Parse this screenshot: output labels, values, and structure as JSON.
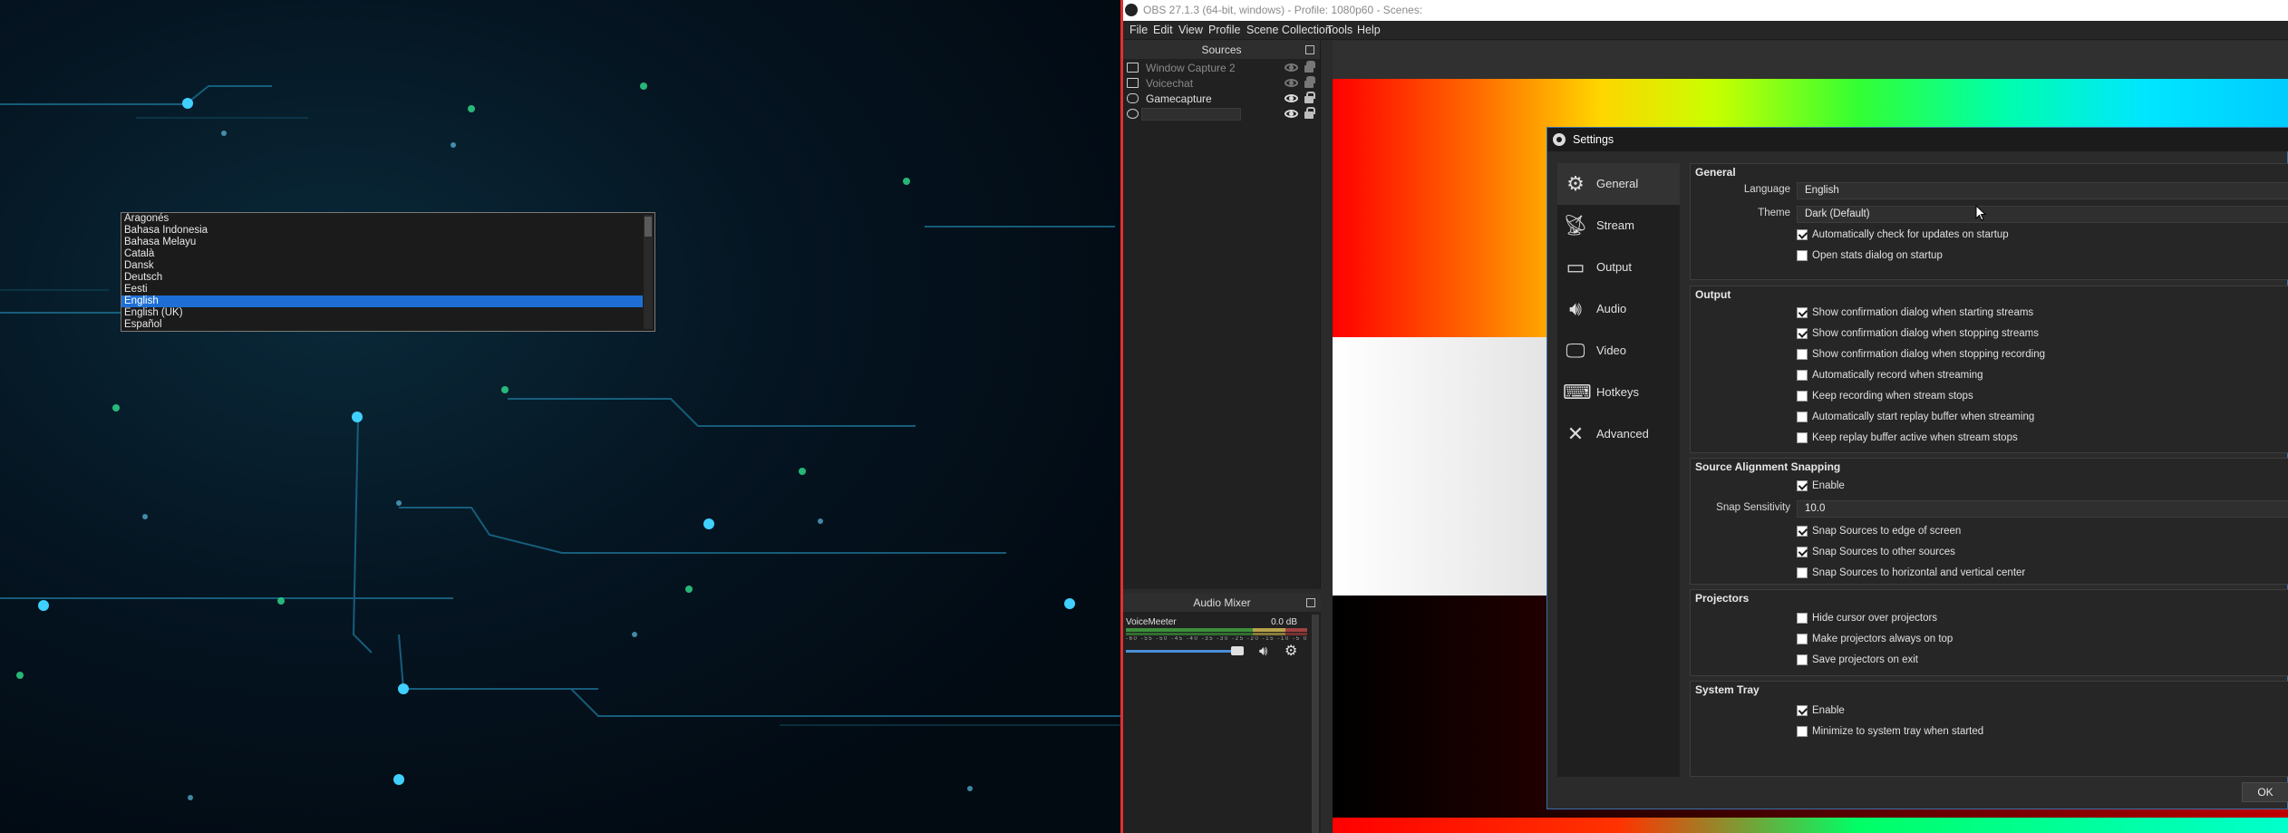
{
  "language_dropdown": {
    "items": [
      "Aragonés",
      "Bahasa Indonesia",
      "Bahasa Melayu",
      "Català",
      "Dansk",
      "Deutsch",
      "Eesti",
      "English",
      "English (UK)",
      "Español"
    ],
    "selected": "English",
    "selected_color": "#1d6fd6"
  },
  "obs": {
    "title": "OBS 27.1.3 (64-bit, windows) - Profile: 1080p60 - Scenes:",
    "menu": [
      "File",
      "Edit",
      "View",
      "Profile",
      "Scene Collection",
      "Tools",
      "Help"
    ],
    "sources": {
      "title": "Sources",
      "items": [
        {
          "name": "Window Capture 2",
          "visible": false,
          "icon": "window-icon"
        },
        {
          "name": "Voicechat",
          "visible": false,
          "icon": "list-icon"
        },
        {
          "name": "Gamecapture",
          "visible": true,
          "icon": "gamepad-icon"
        },
        {
          "name": "",
          "visible": true,
          "icon": "globe-icon",
          "renaming": true
        }
      ],
      "toolbar": [
        "+",
        "−",
        "⚙",
        "∧",
        "∨"
      ]
    },
    "audio_mixer": {
      "title": "Audio Mixer",
      "channel": {
        "name": "VoiceMeeter",
        "db": "0.0 dB",
        "ticks": "-60 -55 -50 -45 -40 -35 -30 -25 -20 -15 -10 -5 0",
        "volume_percent": 88
      }
    }
  },
  "settings": {
    "title": "Settings",
    "nav": [
      {
        "label": "General",
        "icon": "gear-icon",
        "active": true
      },
      {
        "label": "Stream",
        "icon": "antenna-icon",
        "active": false
      },
      {
        "label": "Output",
        "icon": "output-icon",
        "active": false
      },
      {
        "label": "Audio",
        "icon": "speaker-icon",
        "active": false
      },
      {
        "label": "Video",
        "icon": "monitor-icon",
        "active": false
      },
      {
        "label": "Hotkeys",
        "icon": "keyboard-icon",
        "active": false
      },
      {
        "label": "Advanced",
        "icon": "wrench-icon",
        "active": false
      }
    ],
    "general": {
      "title": "General",
      "language_label": "Language",
      "language_value": "English",
      "theme_label": "Theme",
      "theme_value": "Dark (Default)",
      "checks": [
        {
          "label": "Automatically check for updates on startup",
          "checked": true
        },
        {
          "label": "Open stats dialog on startup",
          "checked": false
        }
      ]
    },
    "output": {
      "title": "Output",
      "checks": [
        {
          "label": "Show confirmation dialog when starting streams",
          "checked": true
        },
        {
          "label": "Show confirmation dialog when stopping streams",
          "checked": true
        },
        {
          "label": "Show confirmation dialog when stopping recording",
          "checked": false
        },
        {
          "label": "Automatically record when streaming",
          "checked": false
        },
        {
          "label": "Keep recording when stream stops",
          "checked": false
        },
        {
          "label": "Automatically start replay buffer when streaming",
          "checked": false
        },
        {
          "label": "Keep replay buffer active when stream stops",
          "checked": false
        }
      ]
    },
    "snapping": {
      "title": "Source Alignment Snapping",
      "enable_label": "Enable",
      "enable_checked": true,
      "sensitivity_label": "Snap Sensitivity",
      "sensitivity_value": "10.0",
      "checks": [
        {
          "label": "Snap Sources to edge of screen",
          "checked": true
        },
        {
          "label": "Snap Sources to other sources",
          "checked": true
        },
        {
          "label": "Snap Sources to horizontal and vertical center",
          "checked": false
        }
      ]
    },
    "projectors": {
      "title": "Projectors",
      "checks": [
        {
          "label": "Hide cursor over projectors",
          "checked": false
        },
        {
          "label": "Make projectors always on top",
          "checked": false
        },
        {
          "label": "Save projectors on exit",
          "checked": false
        }
      ]
    },
    "system_tray": {
      "title": "System Tray",
      "checks": [
        {
          "label": "Enable",
          "checked": true
        },
        {
          "label": "Minimize to system tray when started",
          "checked": false
        }
      ]
    },
    "ok_label": "OK"
  }
}
